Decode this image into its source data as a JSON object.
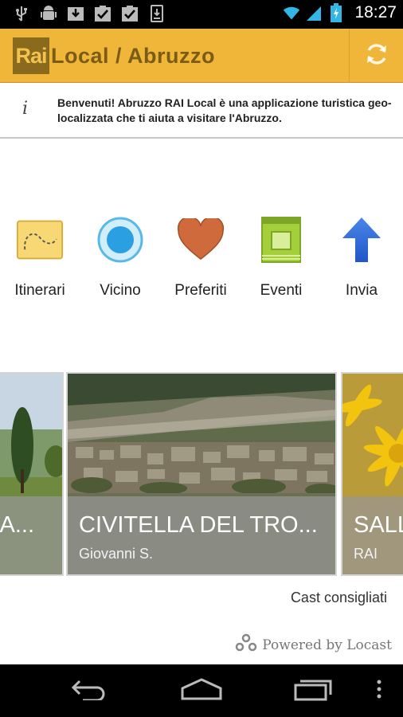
{
  "status_bar": {
    "time": "18:27",
    "left_icons": [
      "usb-icon",
      "android-debug-icon",
      "download-icon",
      "clipboard-check-icon",
      "clipboard-check-icon",
      "download-complete-icon"
    ],
    "right_icons": [
      "wifi-icon",
      "signal-icon",
      "battery-charging-icon"
    ]
  },
  "action_bar": {
    "logo_badge": "Rai",
    "logo_text": "Local / Abruzzo",
    "refresh_icon": "refresh-icon",
    "color": "#efb63a"
  },
  "info_banner": {
    "icon": "i",
    "text": "Benvenuti! Abruzzo RAI Local è una applicazione turistica geo-localizzata che ti aiuta a visitare l'Abruzzo."
  },
  "menu": {
    "items": [
      {
        "label": "Itinerari",
        "icon": "map-route-icon"
      },
      {
        "label": "Vicino",
        "icon": "location-circle-icon"
      },
      {
        "label": "Preferiti",
        "icon": "heart-icon"
      },
      {
        "label": "Eventi",
        "icon": "event-calendar-icon"
      },
      {
        "label": "Invia",
        "icon": "upload-arrow-icon"
      }
    ]
  },
  "carousel": {
    "cards": [
      {
        "title": "'A...",
        "subtitle": ""
      },
      {
        "title": "CIVITELLA DEL TRO...",
        "subtitle": "Giovanni S."
      },
      {
        "title": "SALL",
        "subtitle": "RAI"
      }
    ]
  },
  "section_label": "Cast consigliati",
  "powered_by": "Powered by Locast",
  "nav_bar": {
    "icons": [
      "back-icon",
      "home-icon",
      "recent-apps-icon",
      "overflow-menu-icon"
    ]
  }
}
